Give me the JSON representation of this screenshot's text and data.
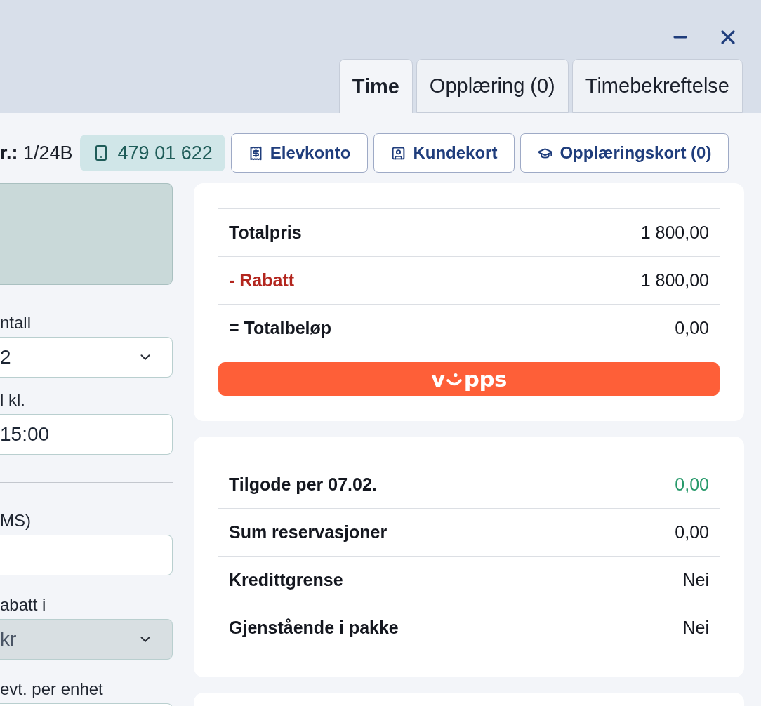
{
  "tabs": [
    {
      "label": "Time",
      "selected": true
    },
    {
      "label": "Opplæring (0)",
      "selected": false
    },
    {
      "label": "Timebekreftelse",
      "selected": false
    }
  ],
  "header": {
    "order_number": "**r.:** 1/24B",
    "phone": "479 01 622",
    "buttons": [
      {
        "kind": "account",
        "label": "Elevkonto"
      },
      {
        "kind": "customer_card",
        "label": "Kundekort"
      },
      {
        "kind": "training_card",
        "label": "Opplæringskort (0)"
      }
    ]
  },
  "left_panel": {
    "field_groups": [
      [
        {
          "kind": "select",
          "label": "ntall",
          "value": "2",
          "disabled": false
        },
        {
          "kind": "text",
          "label": "l kl.",
          "value": "15:00",
          "disabled": false
        }
      ],
      [
        {
          "kind": "text",
          "label": "MS)",
          "disabled": false
        },
        {
          "kind": "select",
          "label": "abatt i",
          "value": "kr",
          "disabled": true
        },
        {
          "kind": "text",
          "label": "evt. per enhet",
          "disabled": false
        }
      ]
    ]
  },
  "price_card": {
    "rows": [
      {
        "kind": "plain",
        "label": "Totalpris",
        "value": "1 800,00"
      },
      {
        "kind": "discount",
        "label": "- Rabatt",
        "value": "1 800,00"
      },
      {
        "kind": "plain",
        "label": "= Totalbeløp",
        "value": "0,00"
      }
    ],
    "pay_button": {
      "logo_start": "v",
      "logo_end": "pps"
    }
  },
  "balance_card": {
    "rows": [
      {
        "kind": "credit",
        "label": "Tilgode per 07.02.",
        "value": "0,00"
      },
      {
        "kind": "plain",
        "label": "Sum reservasjoner",
        "value": "0,00"
      },
      {
        "kind": "plain",
        "label": "Kredittgrense",
        "value": "Nei"
      },
      {
        "kind": "plain",
        "label": "Gjenstående i pakke",
        "value": "Nei"
      }
    ]
  }
}
